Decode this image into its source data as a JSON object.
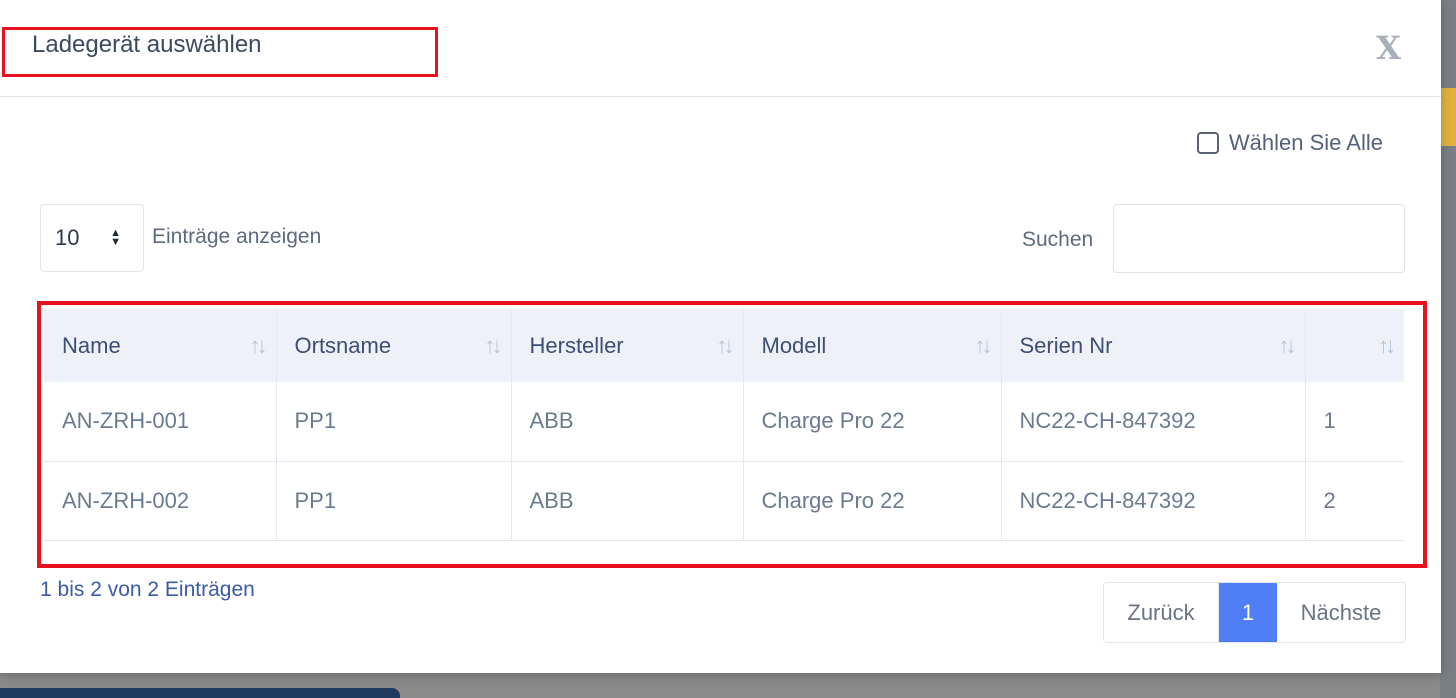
{
  "modal": {
    "title": "Ladegerät auswählen",
    "close_label": "X",
    "select_all_label": "Wählen Sie Alle"
  },
  "controls": {
    "page_length_value": "10",
    "page_length_label": "Einträge anzeigen",
    "search_label": "Suchen",
    "search_value": ""
  },
  "table": {
    "columns": [
      "Name",
      "Ortsname",
      "Hersteller",
      "Modell",
      "Serien Nr",
      ""
    ],
    "rows": [
      [
        "AN-ZRH-001",
        "PP1",
        "ABB",
        "Charge Pro 22",
        "NC22-CH-847392",
        "1"
      ],
      [
        "AN-ZRH-002",
        "PP1",
        "ABB",
        "Charge Pro 22",
        "NC22-CH-847392",
        "2"
      ]
    ]
  },
  "footer": {
    "info": "1 bis 2 von 2 Einträgen",
    "prev_label": "Zurück",
    "current_page": "1",
    "next_label": "Nächste"
  },
  "colors": {
    "highlight_border": "#e8101c",
    "active_page": "#4f7ef7"
  }
}
